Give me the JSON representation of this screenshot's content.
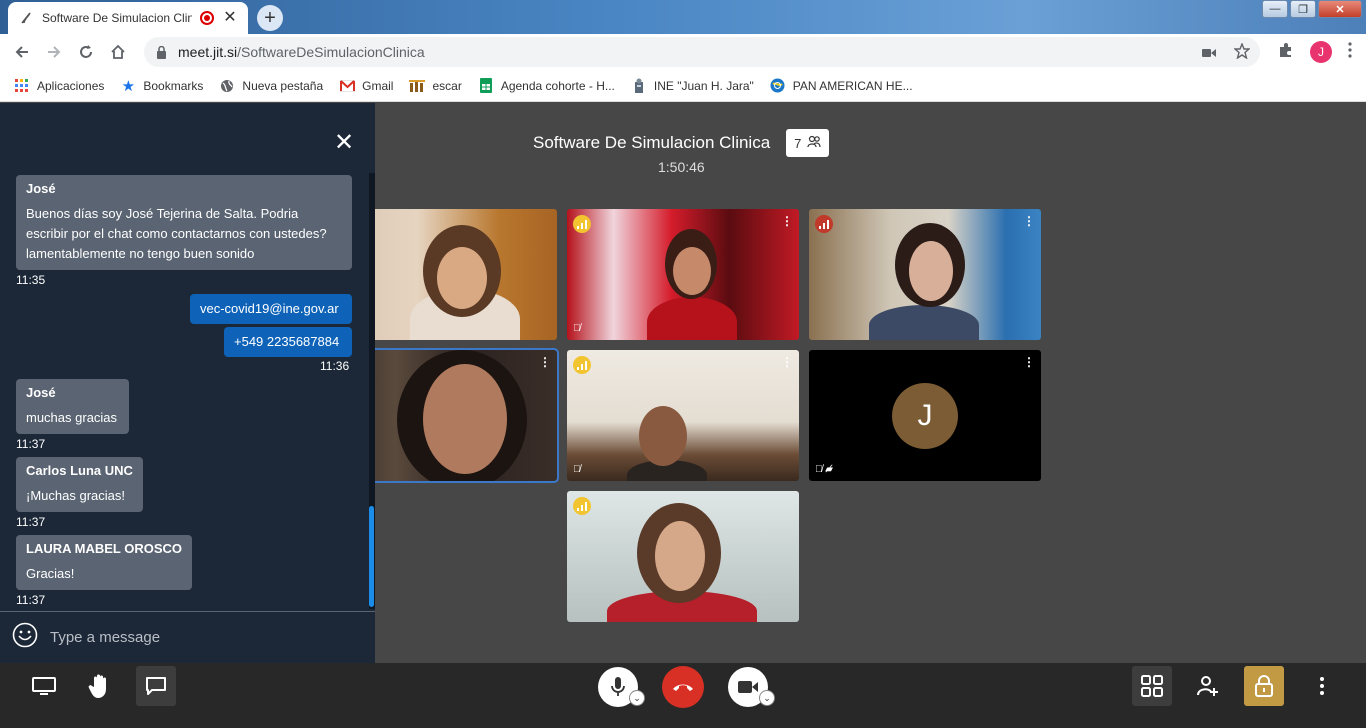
{
  "browser": {
    "tab_title": "Software De Simulacion Clinica",
    "new_tab_symbol": "+",
    "url_host": "meet.jit.si",
    "url_path": "/SoftwareDeSimulacionClinica",
    "profile_initial": "J",
    "window_buttons": [
      "—",
      "❐",
      "✕"
    ]
  },
  "bookmarks": [
    {
      "label": "Aplicaciones",
      "icon": "apps-grid-icon"
    },
    {
      "label": "Bookmarks",
      "icon": "star-icon"
    },
    {
      "label": "Nueva pestaña",
      "icon": "globe-icon"
    },
    {
      "label": "Gmail",
      "icon": "gmail-icon"
    },
    {
      "label": "escar",
      "icon": "escar-icon"
    },
    {
      "label": "Agenda cohorte - H...",
      "icon": "sheets-icon"
    },
    {
      "label": "INE \"Juan H. Jara\"",
      "icon": "ine-icon"
    },
    {
      "label": "PAN AMERICAN HE...",
      "icon": "paho-icon"
    }
  ],
  "meeting": {
    "title": "Software De Simulacion Clinica",
    "participant_count": "7",
    "timer": "1:50:46",
    "avatar_initial": "J"
  },
  "chat": {
    "messages": [
      {
        "sender": "José",
        "text": "Buenos días soy José Tejerina de Salta. Podria escribir por el chat como contactarnos con ustedes? lamentablemente no tengo buen sonido",
        "time": "11:35"
      },
      {
        "text": "vec-covid19@ine.gov.ar"
      },
      {
        "text": "+549 2235687884",
        "time": "11:36"
      },
      {
        "sender": "José",
        "text": "muchas gracias",
        "time": "11:37"
      },
      {
        "sender": "Carlos Luna UNC",
        "text": "¡Muchas gracias!",
        "time": "11:37"
      },
      {
        "sender": "LAURA MABEL OROSCO",
        "text": "Gracias!",
        "time": "11:37"
      }
    ],
    "input_placeholder": "Type a message"
  },
  "colors": {
    "accent": "#1b8ce8",
    "hangup": "#d93025",
    "lock_button": "#c29a44",
    "chat_bg": "#1c2838",
    "own_message": "#0e63b8"
  }
}
